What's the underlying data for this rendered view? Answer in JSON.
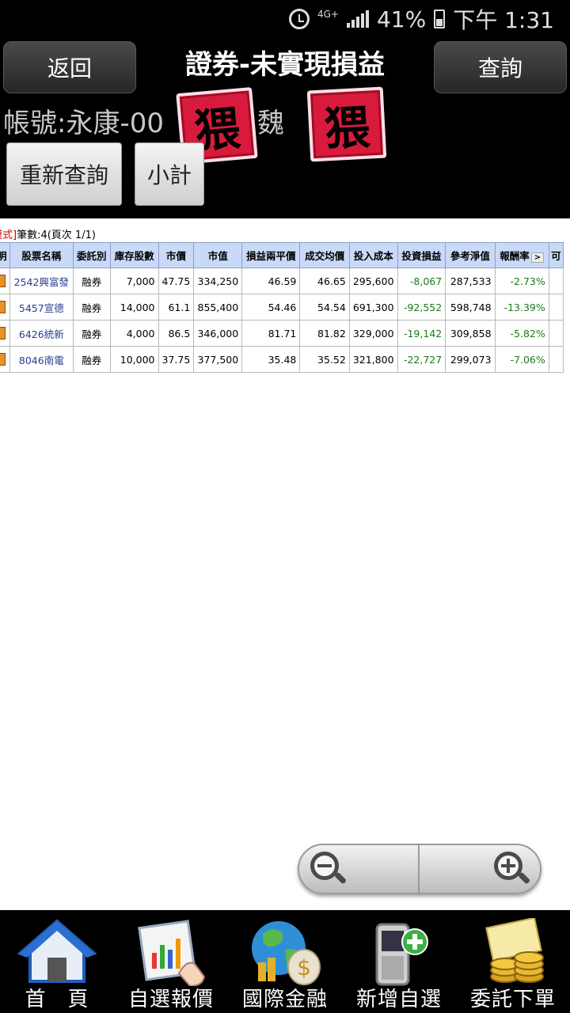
{
  "status_bar": {
    "network": "4G+",
    "battery": "41%",
    "time": "下午 1:31"
  },
  "header": {
    "back_label": "返回",
    "title": "證券-未實現損益",
    "query_label": "查詢",
    "account_text": "帳號:永康-00",
    "account_name": "魏",
    "stamp_char": "猥"
  },
  "actions": {
    "requery_label": "重新查詢",
    "subtotal_label": "小計"
  },
  "info": {
    "mode": "模式]",
    "count_text": "筆數:4(頁次 1/1)"
  },
  "table": {
    "columns": [
      "明",
      "股票名稱",
      "委託別",
      "庫存股數",
      "市價",
      "市值",
      "損益兩平價",
      "成交均價",
      "投入成本",
      "投資損益",
      "參考淨值",
      "報酬率",
      "可"
    ],
    "more_label": ">",
    "rows": [
      {
        "stock": "2542興富發",
        "type": "融券",
        "shares": "7,000",
        "price": "47.75",
        "value": "334,250",
        "breakeven": "46.59",
        "avg": "46.65",
        "cost": "295,600",
        "pl": "-8,067",
        "net": "287,533",
        "ret": "-2.73%"
      },
      {
        "stock": "5457宣德",
        "type": "融券",
        "shares": "14,000",
        "price": "61.1",
        "value": "855,400",
        "breakeven": "54.46",
        "avg": "54.54",
        "cost": "691,300",
        "pl": "-92,552",
        "net": "598,748",
        "ret": "-13.39%"
      },
      {
        "stock": "6426統新",
        "type": "融券",
        "shares": "4,000",
        "price": "86.5",
        "value": "346,000",
        "breakeven": "81.71",
        "avg": "81.82",
        "cost": "329,000",
        "pl": "-19,142",
        "net": "309,858",
        "ret": "-5.82%"
      },
      {
        "stock": "8046南電",
        "type": "融券",
        "shares": "10,000",
        "price": "37.75",
        "value": "377,500",
        "breakeven": "35.48",
        "avg": "35.52",
        "cost": "321,800",
        "pl": "-22,727",
        "net": "299,073",
        "ret": "-7.06%"
      }
    ]
  },
  "bottom_nav": [
    {
      "label": "首　頁",
      "icon": "home-icon"
    },
    {
      "label": "自選報價",
      "icon": "chart-quote-icon"
    },
    {
      "label": "國際金融",
      "icon": "globe-money-icon"
    },
    {
      "label": "新增自選",
      "icon": "phone-add-icon"
    },
    {
      "label": "委託下單",
      "icon": "coins-order-icon"
    }
  ],
  "colors": {
    "header_bg": "#000000",
    "table_header": "#c9daf8",
    "negative": "#1a7a1a",
    "stamp": "#d81b3c"
  }
}
